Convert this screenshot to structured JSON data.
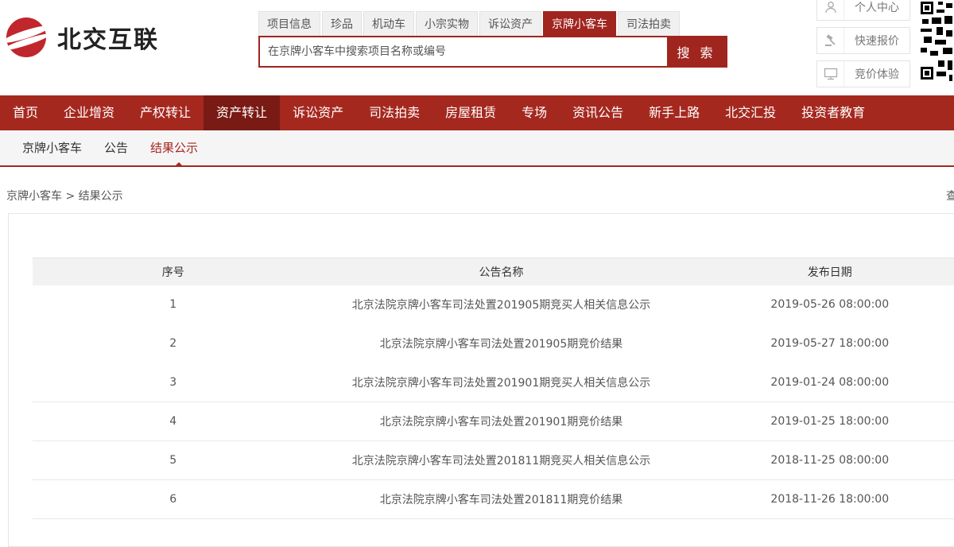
{
  "logo": {
    "text": "北交互联",
    "brand_color": "#c0272d"
  },
  "search": {
    "tabs": [
      {
        "label": "项目信息",
        "active": false
      },
      {
        "label": "珍品",
        "active": false
      },
      {
        "label": "机动车",
        "active": false
      },
      {
        "label": "小宗实物",
        "active": false
      },
      {
        "label": "诉讼资产",
        "active": false
      },
      {
        "label": "京牌小客车",
        "active": true
      },
      {
        "label": "司法拍卖",
        "active": false
      }
    ],
    "placeholder": "在京牌小客车中搜索项目名称或编号",
    "button_label": "搜 索"
  },
  "side_links": [
    {
      "label": "个人中心",
      "icon": "user-icon"
    },
    {
      "label": "快速报价",
      "icon": "gavel-icon"
    },
    {
      "label": "竞价体验",
      "icon": "monitor-icon"
    }
  ],
  "main_nav": [
    {
      "label": "首页",
      "active": false
    },
    {
      "label": "企业增资",
      "active": false
    },
    {
      "label": "产权转让",
      "active": false
    },
    {
      "label": "资产转让",
      "active": true
    },
    {
      "label": "诉讼资产",
      "active": false
    },
    {
      "label": "司法拍卖",
      "active": false
    },
    {
      "label": "房屋租赁",
      "active": false
    },
    {
      "label": "专场",
      "active": false
    },
    {
      "label": "资讯公告",
      "active": false
    },
    {
      "label": "新手上路",
      "active": false
    },
    {
      "label": "北交汇投",
      "active": false
    },
    {
      "label": "投资者教育",
      "active": false
    }
  ],
  "sub_nav": [
    {
      "label": "京牌小客车",
      "active": false
    },
    {
      "label": "公告",
      "active": false
    },
    {
      "label": "结果公示",
      "active": true
    }
  ],
  "breadcrumb": "京牌小客车 > 结果公示",
  "edge_text": "查",
  "table": {
    "headers": [
      "序号",
      "公告名称",
      "发布日期"
    ],
    "rows": [
      [
        "1",
        "北京法院京牌小客车司法处置201905期竞买人相关信息公示",
        "2019-05-26 08:00:00"
      ],
      [
        "2",
        "北京法院京牌小客车司法处置201905期竞价结果",
        "2019-05-27 18:00:00"
      ],
      [
        "3",
        "北京法院京牌小客车司法处置201901期竞买人相关信息公示",
        "2019-01-24 08:00:00"
      ],
      [
        "4",
        "北京法院京牌小客车司法处置201901期竞价结果",
        "2019-01-25 18:00:00"
      ],
      [
        "5",
        "北京法院京牌小客车司法处置201811期竞买人相关信息公示",
        "2018-11-25 08:00:00"
      ],
      [
        "6",
        "北京法院京牌小客车司法处置201811期竞价结果",
        "2018-11-26 18:00:00"
      ]
    ]
  },
  "colors": {
    "accent": "#a5281f",
    "nav_active": "#7a1a14"
  }
}
